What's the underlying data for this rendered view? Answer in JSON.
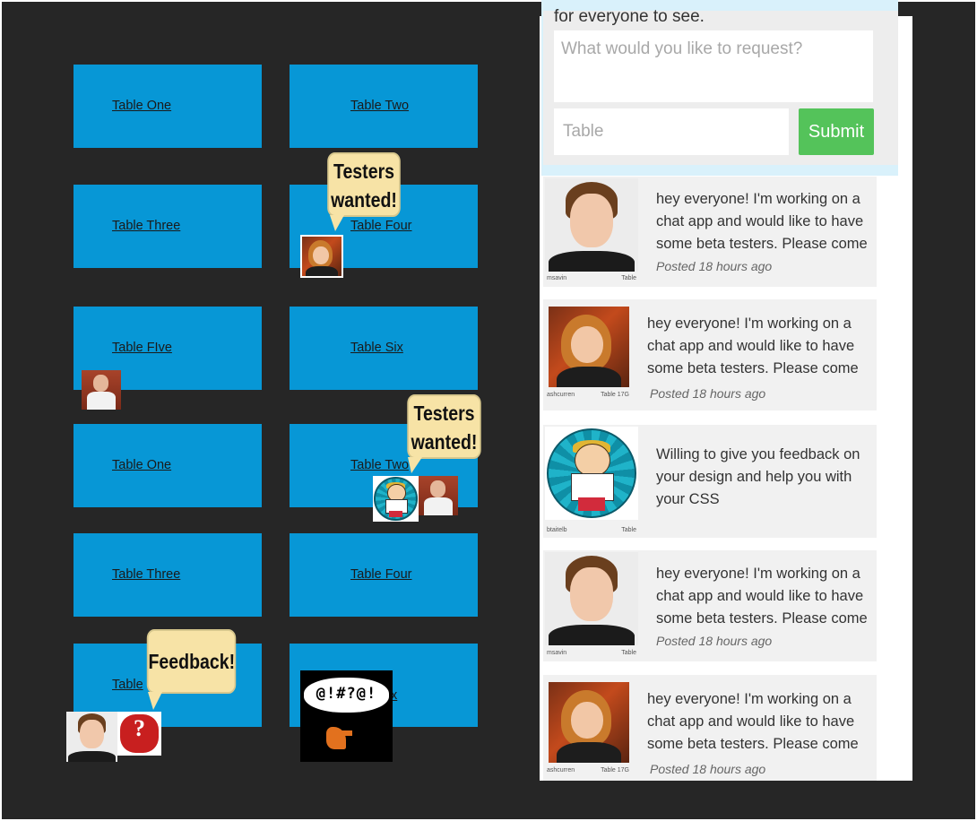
{
  "tables": [
    {
      "label": "Table One"
    },
    {
      "label": "Table Two"
    },
    {
      "label": "Table Three"
    },
    {
      "label": "Table Four"
    },
    {
      "label": "Table FIve"
    },
    {
      "label": "Table Six"
    },
    {
      "label": "Table One"
    },
    {
      "label": "Table Two"
    },
    {
      "label": "Table Three"
    },
    {
      "label": "Table Four"
    },
    {
      "label": "Table"
    },
    {
      "label": "x"
    }
  ],
  "bubbles": {
    "testers1": "Testers wanted!",
    "testers2": "Testers wanted!",
    "feedback": "Feedback!"
  },
  "pixel_text": "@!#?@!",
  "request": {
    "heading": "for everyone to see.",
    "textarea_placeholder": "What would you like to request?",
    "table_placeholder": "Table",
    "submit_label": "Submit"
  },
  "posts": [
    {
      "user": "msavin",
      "table": "Table",
      "text": "hey everyone! I'm working on a chat app and would like to have some beta testers. Please come",
      "time": "Posted 18 hours ago",
      "avatar": "guy"
    },
    {
      "user": "ashcurren",
      "table": "Table 17G",
      "text": "hey everyone! I'm working on a chat app and would like to have some beta testers. Please come",
      "time": "Posted 18 hours ago",
      "avatar": "woman"
    },
    {
      "user": "btaitelb",
      "table": "Table",
      "text": "Willing to give you feedback on your design and help you with your CSS",
      "time": "",
      "avatar": "toon"
    },
    {
      "user": "msavin",
      "table": "Table",
      "text": "hey everyone! I'm working on a chat app and would like to have some beta testers. Please come",
      "time": "Posted 18 hours ago",
      "avatar": "guy"
    },
    {
      "user": "ashcurren",
      "table": "Table 17G",
      "text": "hey everyone! I'm working on a chat app and would like to have some beta testers. Please come",
      "time": "Posted 18 hours ago",
      "avatar": "woman"
    }
  ]
}
